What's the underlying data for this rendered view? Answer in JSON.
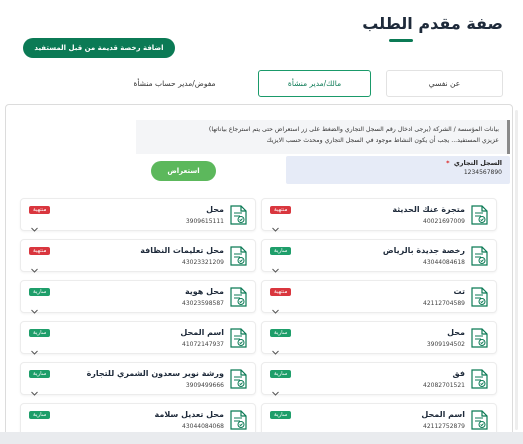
{
  "page": {
    "title": "صفة مقدم الطلب",
    "add_old_license_label": "اضافة رخصة قديمة من قبل المستفيد"
  },
  "tabs": [
    {
      "label": "عن نفسي"
    },
    {
      "label": "مالك/مدير منشأة"
    },
    {
      "label": "مفوض/مدير حساب منشأة"
    }
  ],
  "info": {
    "line1": "بيانات المؤسسة / الشركة (يرجى ادخال رقم السجل التجاري والضغط على زر استعراض حتى يتم استرجاع بياناتها)",
    "line2": "عزيزي المستفيد... يجب أن يكون النشاط موجود في السجل التجاري ومحدث حسب الايزيك"
  },
  "cr": {
    "label": "السجل التجاري",
    "required_mark": "*",
    "value": "1234567890"
  },
  "query_label": "استعراض",
  "statuses": {
    "expired": "منتهية",
    "valid": "سارية"
  },
  "colors": {
    "primary": "#0b7a55",
    "query": "#5cb85c",
    "expired": "#d9363e",
    "valid": "#1e9e6a",
    "info_bg": "#f4f5f7",
    "cr_bg": "#e6ebf7"
  },
  "cards_right": [
    {
      "name": "متجرة عنك الحديثة",
      "number": "40021697009",
      "status": "منتهية"
    },
    {
      "name": "رخصة جديدة بالرياض",
      "number": "43044084618",
      "status": "سارية"
    },
    {
      "name": "تت",
      "number": "42112704589",
      "status": "منتهية"
    },
    {
      "name": "محل",
      "number": "3909194502",
      "status": "سارية"
    },
    {
      "name": "فق",
      "number": "42082701521",
      "status": "سارية"
    },
    {
      "name": "اسم المحل",
      "number": "42112752879",
      "status": "سارية"
    }
  ],
  "cards_left": [
    {
      "name": "محل",
      "number": "3909615111",
      "status": "منتهية"
    },
    {
      "name": "محل تعليمات النظافة",
      "number": "43023321209",
      "status": "منتهية"
    },
    {
      "name": "محل هوية",
      "number": "43023598587",
      "status": "سارية"
    },
    {
      "name": "اسم المحل",
      "number": "41072147937",
      "status": "سارية"
    },
    {
      "name": "ورشة نوير سعدون الشمري للتجارة",
      "number": "3909499666",
      "status": "سارية"
    },
    {
      "name": "محل تعديل سلامة",
      "number": "43044084068",
      "status": "سارية"
    }
  ]
}
